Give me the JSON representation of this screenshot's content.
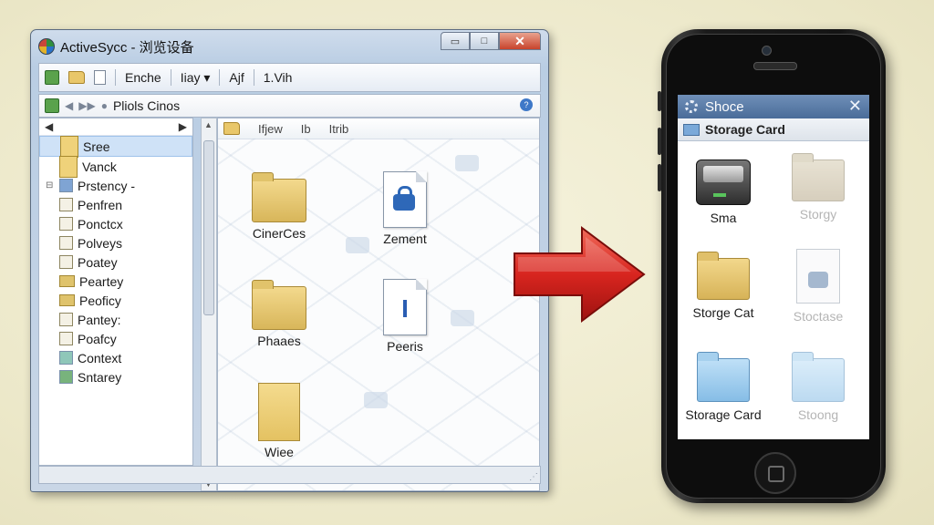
{
  "window": {
    "title": "ActiveSycc - 浏览设备",
    "controls": {
      "minimize": "▭",
      "maximize": "□",
      "close": "✕"
    },
    "toolbar": {
      "menu_1": "Enche",
      "menu_2": "Iiay",
      "menu_2_caret": "▾",
      "menu_3": "Ajf",
      "menu_4": "1.Vih"
    },
    "address": {
      "back": "◀",
      "forward": "▶▶",
      "path": "Pliols Cinos",
      "help": "?"
    },
    "nav": {
      "left_arrow": "◀",
      "right_arrow": "▶"
    },
    "tree": [
      {
        "label": "Sree",
        "icon": "folder-icon",
        "selected": true
      },
      {
        "label": "Vanck",
        "icon": "document-icon"
      },
      {
        "label": "Prstency -",
        "icon": "grid-icon"
      },
      {
        "label": "Penfren",
        "icon": "document-icon"
      },
      {
        "label": "Ponctcx",
        "icon": "document-icon"
      },
      {
        "label": "Polveys",
        "icon": "document-icon"
      },
      {
        "label": "Poatey",
        "icon": "document-icon"
      },
      {
        "label": "Peartey",
        "icon": "folder-icon"
      },
      {
        "label": "Peoficy",
        "icon": "folder-icon"
      },
      {
        "label": "Pantey:",
        "icon": "document-icon"
      },
      {
        "label": "Poafcy",
        "icon": "document-icon"
      },
      {
        "label": "Context",
        "icon": "folder-icon"
      },
      {
        "label": "Sntarey",
        "icon": "folder-icon"
      }
    ],
    "columns": {
      "c1": "Ifjew",
      "c2": "Ib",
      "c3": "Itrib"
    },
    "files": [
      {
        "label": "CinerCes",
        "icon": "folder-icon"
      },
      {
        "label": "Zement",
        "icon": "lock-document-icon"
      },
      {
        "label": "Phaaes",
        "icon": "folder-icon"
      },
      {
        "label": "Peeris",
        "icon": "info-document-icon",
        "glyph": "I"
      },
      {
        "label": "Wiee",
        "icon": "yellow-document-icon"
      }
    ]
  },
  "phone": {
    "title": "Shoce",
    "close": "✕",
    "location": "Storage Card",
    "items": [
      {
        "label": "Sma",
        "icon": "drive-icon"
      },
      {
        "label": "Storgy",
        "icon": "tan-folder-icon",
        "faded": true
      },
      {
        "label": "Storge Cat",
        "icon": "folder-icon"
      },
      {
        "label": "Stoctase",
        "icon": "document-icon",
        "faded": true
      },
      {
        "label": "Storage Card",
        "icon": "blue-folder-icon"
      },
      {
        "label": "Stoong",
        "icon": "blue-folder-icon",
        "faded": true
      }
    ]
  },
  "colors": {
    "arrow": "#d8251f",
    "title_bar": "#4a6c99",
    "selection": "#cfe2f7"
  }
}
